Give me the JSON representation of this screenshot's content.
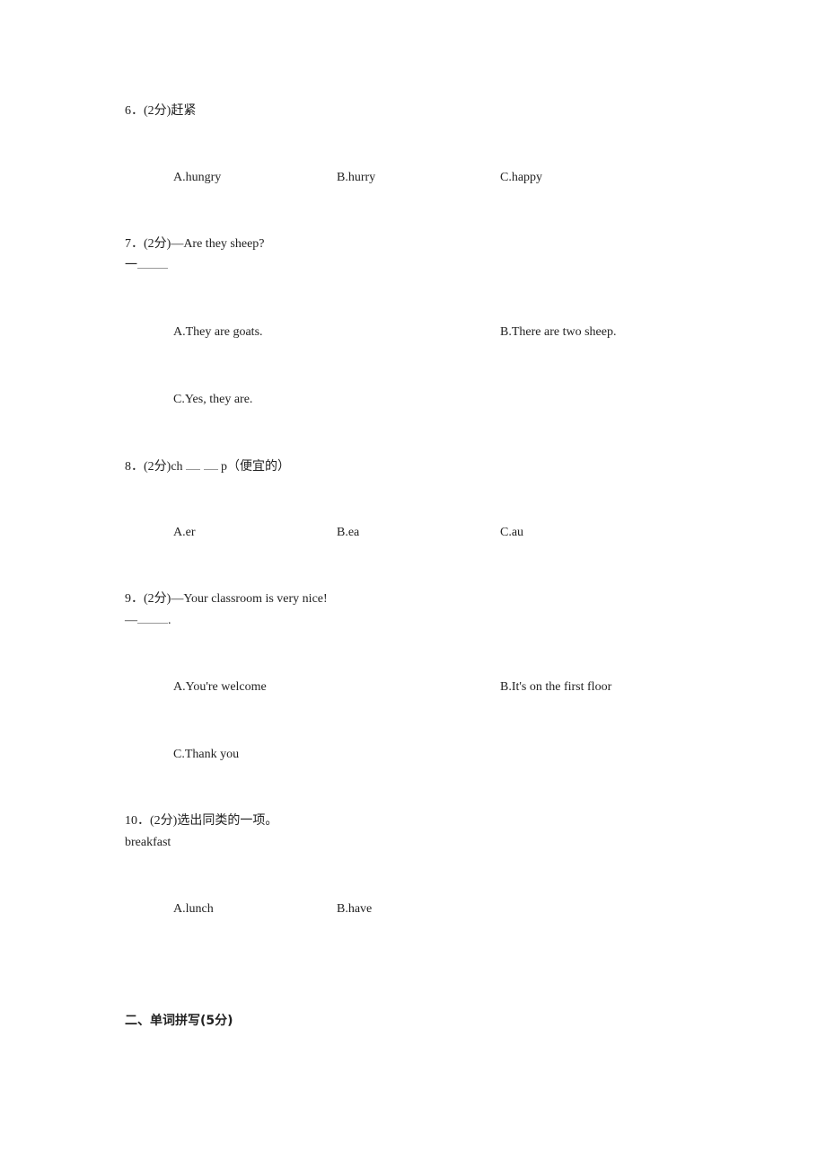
{
  "questions": [
    {
      "stem": "6．(2分)赶紧",
      "options": [
        "A.hungry",
        "B.hurry",
        "C.happy"
      ]
    },
    {
      "stem": "7．(2分)—Are they sheep?",
      "answer_prefix": "一",
      "options": [
        "A.They are goats.",
        "B.There are two sheep.",
        "C.Yes, they are."
      ]
    },
    {
      "stem_prefix": "8．(2分)ch",
      "stem_suffix": "p（便宜的）",
      "options": [
        "A.er",
        "B.ea",
        "C.au"
      ]
    },
    {
      "stem": "9．(2分)—Your classroom is very nice!",
      "answer_prefix": "—",
      "answer_suffix": ".",
      "options": [
        "A.You're welcome",
        "B.It's on the first floor",
        "C.Thank you"
      ]
    },
    {
      "stem": "10．(2分)选出同类的一项。",
      "word": "breakfast",
      "options": [
        "A.lunch",
        "B.have"
      ]
    }
  ],
  "section2": {
    "title": "二、单词拼写(5分)"
  }
}
